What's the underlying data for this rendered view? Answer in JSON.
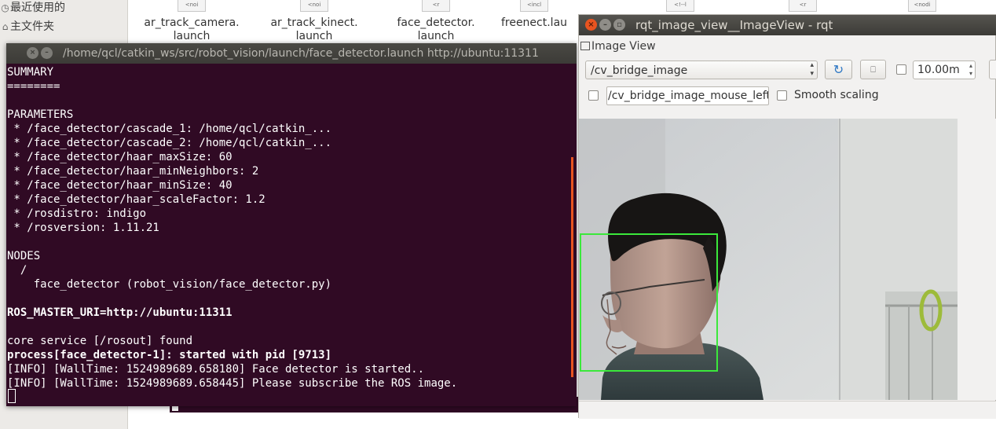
{
  "file_manager": {
    "sidebar_items": [
      {
        "label": "最近使用的",
        "icon": "clock-icon"
      },
      {
        "label": "主文件夹",
        "icon": "home-icon"
      }
    ],
    "files": [
      {
        "name": "ar_track_camera.\nlaunch",
        "thumb": "<noi"
      },
      {
        "name": "ar_track_kinect.\nlaunch",
        "thumb": "<noi"
      },
      {
        "name": "face_detector.\nlaunch",
        "thumb": "<r"
      },
      {
        "name": "freenect.lau",
        "thumb": "<incl"
      }
    ],
    "strip_thumbs": [
      "<!--l",
      "<r",
      "<nodi"
    ]
  },
  "terminal": {
    "title": "/home/qcl/catkin_ws/src/robot_vision/launch/face_detector.launch http://ubuntu:11311",
    "lines": [
      {
        "text": "SUMMARY",
        "bold": false
      },
      {
        "text": "========",
        "bold": false
      },
      {
        "text": "",
        "bold": false
      },
      {
        "text": "PARAMETERS",
        "bold": false
      },
      {
        "text": " * /face_detector/cascade_1: /home/qcl/catkin_...",
        "bold": false
      },
      {
        "text": " * /face_detector/cascade_2: /home/qcl/catkin_...",
        "bold": false
      },
      {
        "text": " * /face_detector/haar_maxSize: 60",
        "bold": false
      },
      {
        "text": " * /face_detector/haar_minNeighbors: 2",
        "bold": false
      },
      {
        "text": " * /face_detector/haar_minSize: 40",
        "bold": false
      },
      {
        "text": " * /face_detector/haar_scaleFactor: 1.2",
        "bold": false
      },
      {
        "text": " * /rosdistro: indigo",
        "bold": false
      },
      {
        "text": " * /rosversion: 1.11.21",
        "bold": false
      },
      {
        "text": "",
        "bold": false
      },
      {
        "text": "NODES",
        "bold": false
      },
      {
        "text": "  /",
        "bold": false
      },
      {
        "text": "    face_detector (robot_vision/face_detector.py)",
        "bold": false
      },
      {
        "text": "",
        "bold": false
      },
      {
        "text": "ROS_MASTER_URI=http://ubuntu:11311",
        "bold": true
      },
      {
        "text": "",
        "bold": false
      },
      {
        "text": "core service [/rosout] found",
        "bold": false
      },
      {
        "text": "process[face_detector-1]: started with pid [9713]",
        "bold": true
      },
      {
        "text": "[INFO] [WallTime: 1524989689.658180] Face detector is started..",
        "bold": false
      },
      {
        "text": "[INFO] [WallTime: 1524989689.658445] Please subscribe the ROS image.",
        "bold": false
      }
    ]
  },
  "rqt": {
    "window_title": "rqt_image_view__ImageView - rqt",
    "dock_title": "Image View",
    "topic": "/cv_bridge_image",
    "rate": "10.00m",
    "mouse_topic": "/cv_bridge_image_mouse_left",
    "smooth_scaling_label": "Smooth scaling",
    "smooth_scaling_checked": false,
    "mouse_publish_checked": false,
    "extra_checked": false,
    "icons": {
      "refresh": "refresh-icon",
      "zoom_fit": "zoom-fit-icon",
      "close": "close-icon",
      "minimize": "minimize-icon",
      "maximize": "maximize-icon"
    },
    "colors": {
      "close_button": "#e95420",
      "terminal_bg": "#300a24",
      "face_box": "#3be83b"
    }
  }
}
